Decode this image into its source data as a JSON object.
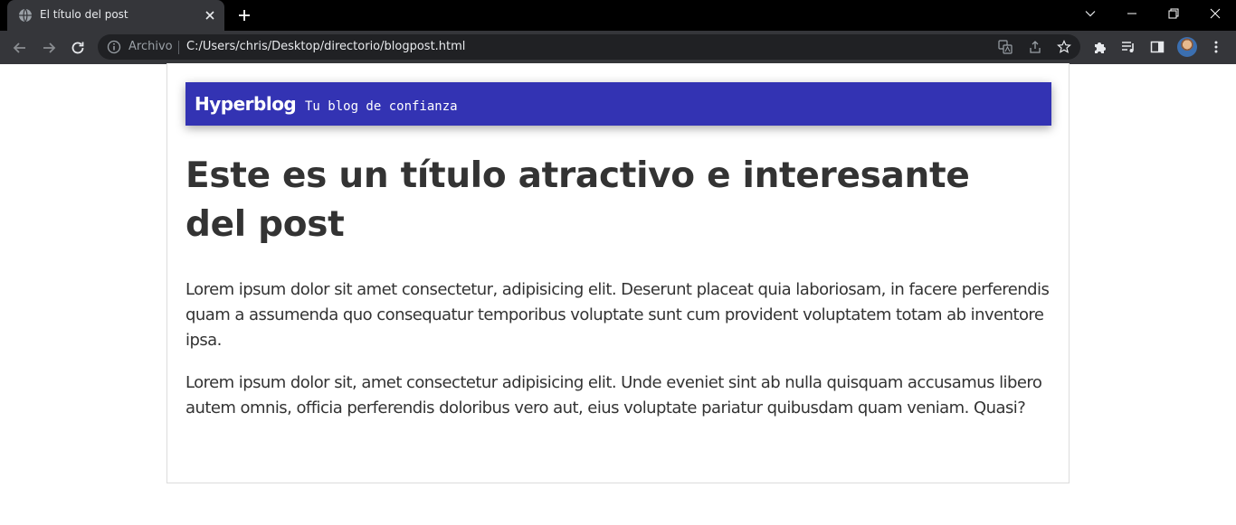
{
  "browser": {
    "tab_title": "El título del post",
    "security_label": "Archivo",
    "url": "C:/Users/chris/Desktop/directorio/blogpost.html",
    "icons": [
      "globe-icon",
      "close-icon",
      "plus-icon",
      "chevron-down-icon",
      "minimize-icon",
      "restore-icon",
      "window-close-icon",
      "back-arrow-icon",
      "forward-arrow-icon",
      "reload-icon",
      "info-icon",
      "translate-icon",
      "share-icon",
      "star-icon",
      "puzzle-icon",
      "media-icon",
      "side-panel-icon",
      "avatar",
      "kebab-menu-icon"
    ]
  },
  "site": {
    "brand": "Hyperblog",
    "tagline": "Tu blog de confianza",
    "header_color": "#3333b3"
  },
  "post": {
    "title": "Este es un título atractivo e interesante del post",
    "paragraphs": [
      "Lorem ipsum dolor sit amet consectetur, adipisicing elit. Deserunt placeat quia laboriosam, in facere perferendis quam a assumenda quo consequatur temporibus voluptate sunt cum provident voluptatem totam ab inventore ipsa.",
      "Lorem ipsum dolor sit, amet consectetur adipisicing elit. Unde eveniet sint ab nulla quisquam accusamus libero autem omnis, officia perferendis doloribus vero aut, eius voluptate pariatur quibusdam quam veniam. Quasi?"
    ]
  }
}
